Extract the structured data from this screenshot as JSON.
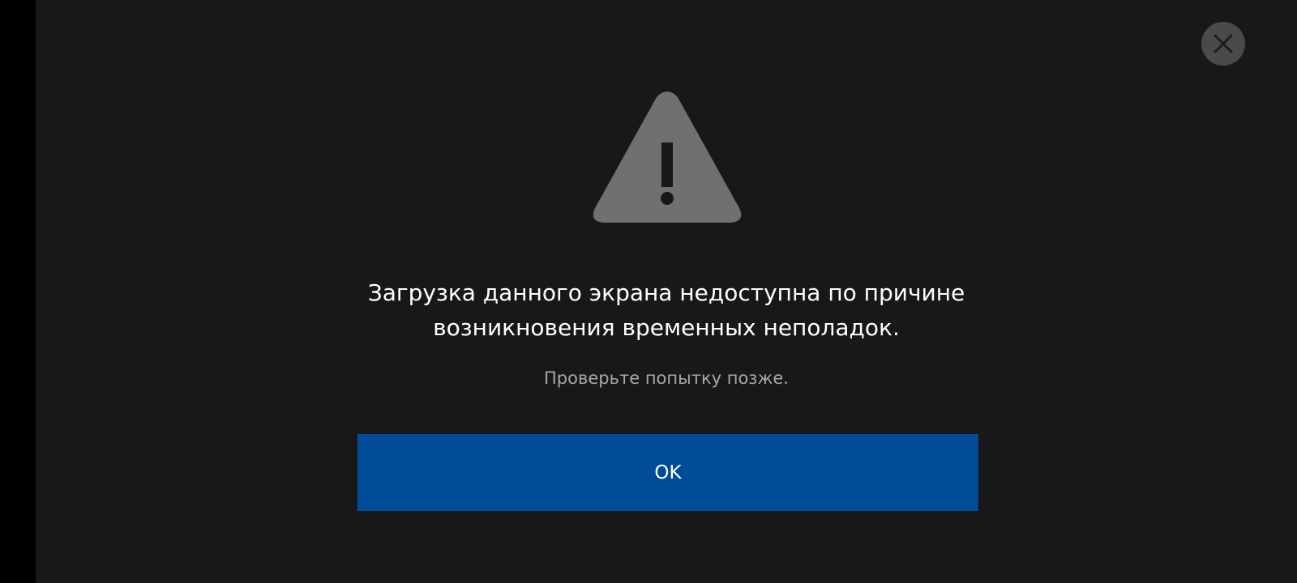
{
  "dialog": {
    "close_icon": "close-icon",
    "warning_icon": "warning-triangle-icon",
    "message": "Загрузка данного экрана недоступна по причине возникновения временных неполадок.",
    "hint": "Проверьте попытку позже.",
    "ok_label": "OK"
  },
  "colors": {
    "background": "#181818",
    "button": "#004c99",
    "icon": "#707070",
    "close_bg": "#4a4a4a"
  }
}
